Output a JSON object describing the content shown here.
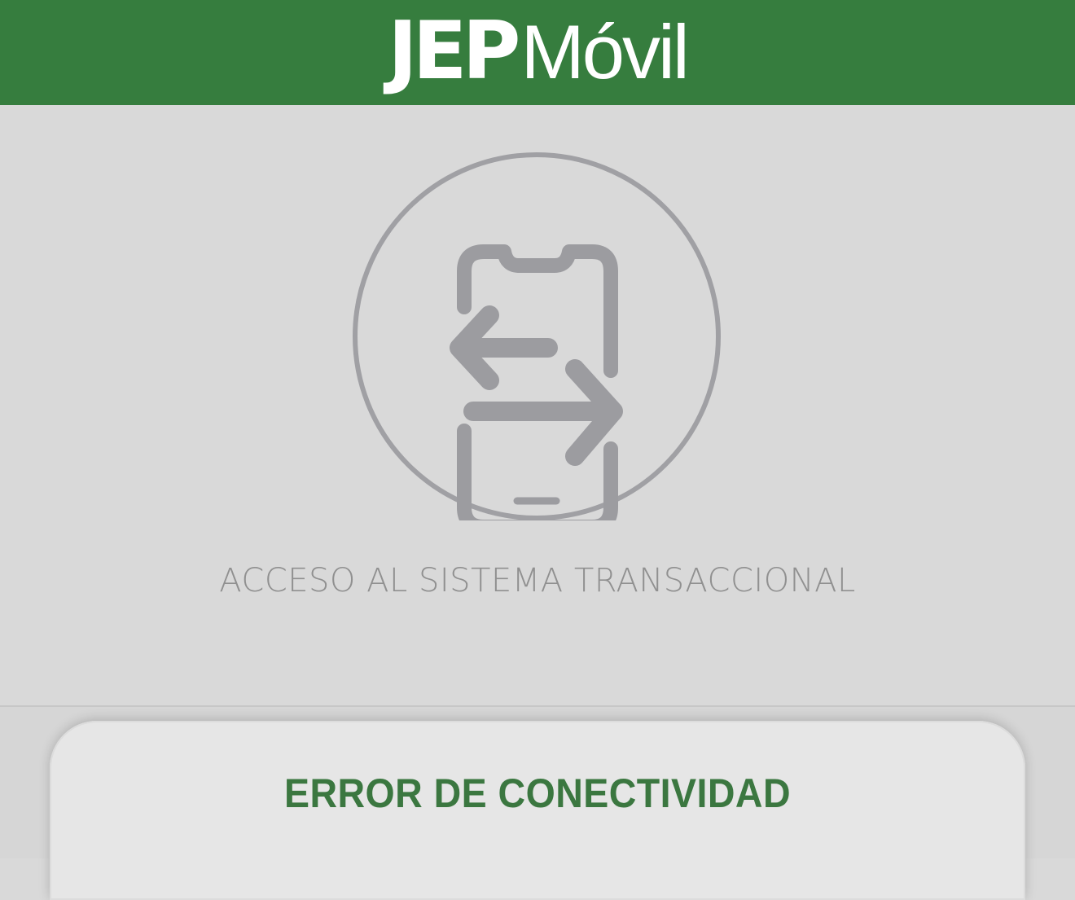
{
  "header": {
    "brand_part1": "JEP",
    "brand_part2": "Móvil",
    "background_color": "#367d3e"
  },
  "hero": {
    "icon": "phone-transfer-icon",
    "caption": "ACCESO AL SISTEMA TRANSACCIONAL"
  },
  "dialog": {
    "title": "ERROR DE CONECTIVIDAD",
    "title_color": "#3b7740"
  }
}
